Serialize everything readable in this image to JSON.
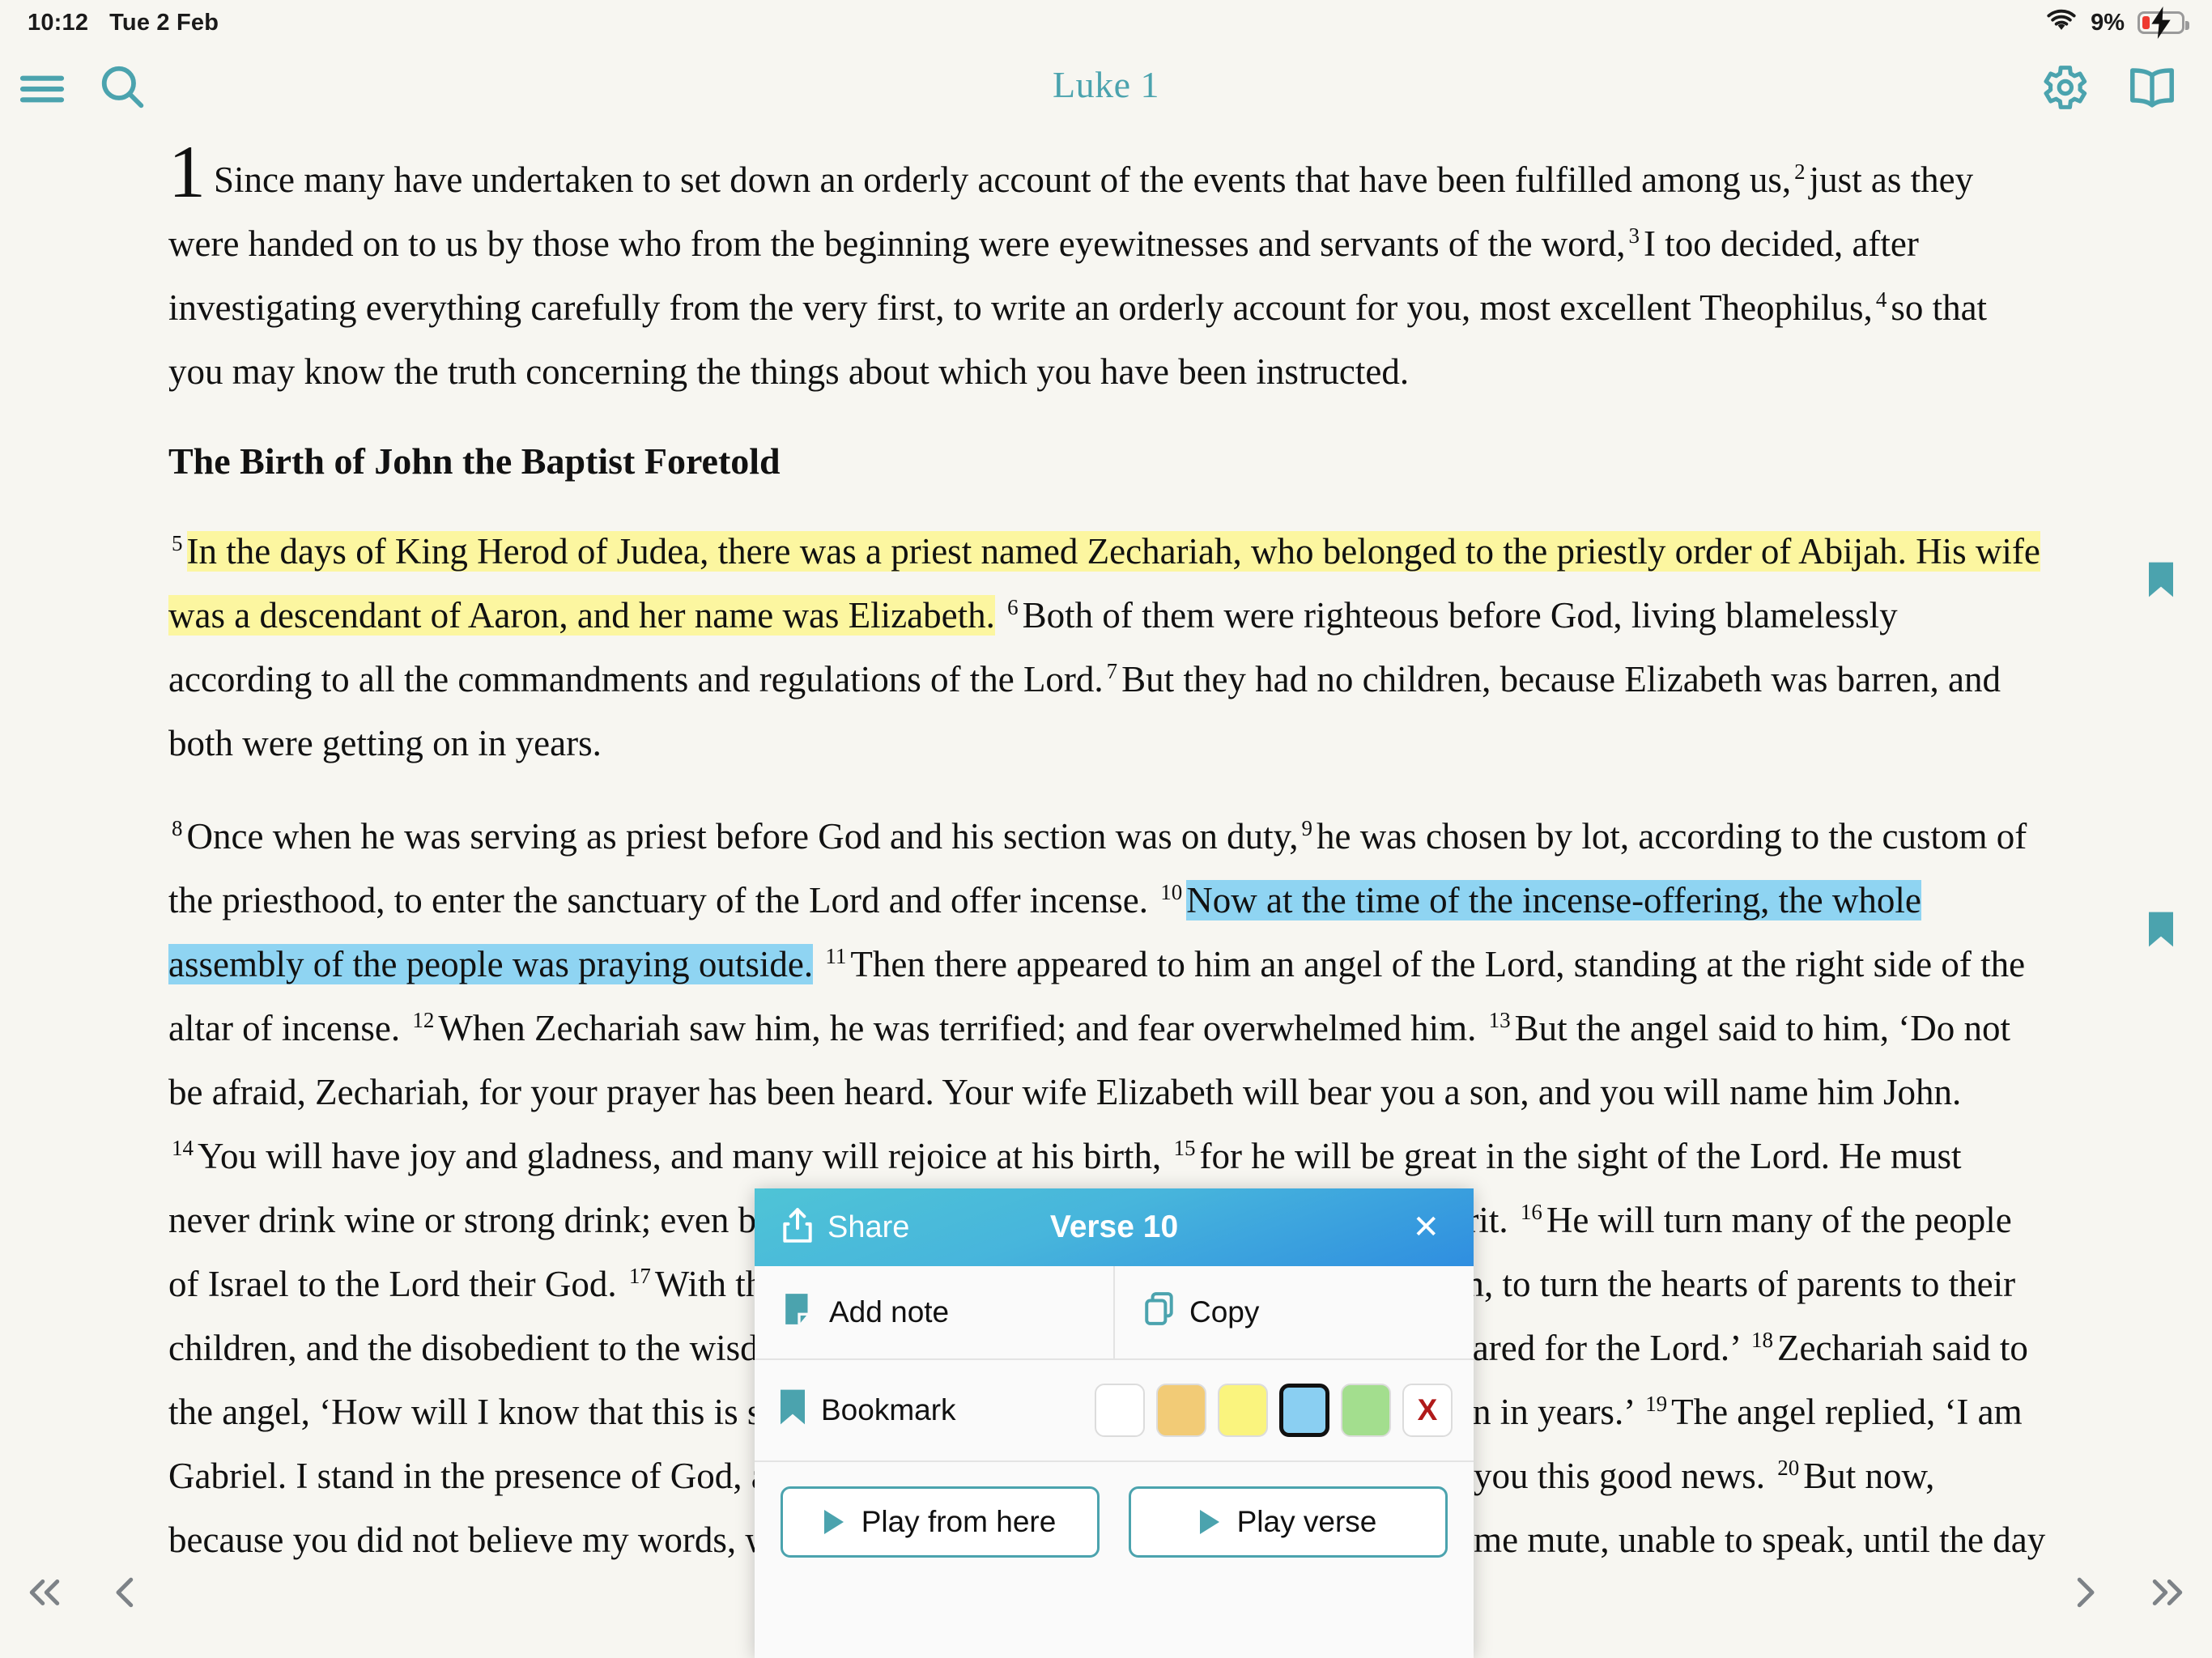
{
  "status_bar": {
    "time": "10:12",
    "date": "Tue 2 Feb",
    "battery_percent": "9%",
    "wifi_icon": "wifi-icon",
    "battery_icon": "battery-charging-icon"
  },
  "toolbar": {
    "menu_icon": "hamburger-menu-icon",
    "search_icon": "search-icon",
    "title": "Luke 1",
    "settings_icon": "gear-icon",
    "book_icon": "open-book-icon",
    "accent_color": "#4BA3AE"
  },
  "chapter": {
    "paragraphs": [
      {
        "id": "p1",
        "dropcap": "1",
        "runs": [
          {
            "text": "Since many have undertaken to set down an orderly account of the events that have been fulfilled among us,",
            "style": "plain"
          },
          {
            "text": "2",
            "style": "versenum"
          },
          {
            "text": "just as they were handed on to us by those who from the beginning were eyewitnesses and servants of the word,",
            "style": "plain"
          },
          {
            "text": "3",
            "style": "versenum"
          },
          {
            "text": "I too decided, after investigating everything carefully from the very first, to write an orderly account for you, most excellent Theophilus,",
            "style": "plain"
          },
          {
            "text": "4",
            "style": "versenum"
          },
          {
            "text": "so that you may know the truth concerning the things about which you have been instructed.",
            "style": "plain"
          }
        ]
      }
    ],
    "heading": "The Birth of John the Baptist Foretold",
    "paragraph2": {
      "id": "p2",
      "runs": [
        {
          "text": "5",
          "style": "versenum"
        },
        {
          "text": "In the days of King Herod of Judea, there was a priest named Zechariah, who belonged to the priestly order of Abijah. His wife was a descendant of Aaron, and her name was Elizabeth.",
          "style": "highlight-yellow"
        },
        {
          "text": "6",
          "style": "versenum"
        },
        {
          "text": "Both of them were righteous before God, living blamelessly according to all the commandments and regulations of the Lord.",
          "style": "plain"
        },
        {
          "text": "7",
          "style": "versenum"
        },
        {
          "text": "But they had no children, because Elizabeth was barren, and both were getting on in years.",
          "style": "plain"
        }
      ]
    },
    "paragraph3": {
      "id": "p3",
      "runs": [
        {
          "text": "8",
          "style": "versenum"
        },
        {
          "text": "Once when he was serving as priest before God and his section was on duty,",
          "style": "plain"
        },
        {
          "text": "9",
          "style": "versenum"
        },
        {
          "text": "he was chosen by lot, according to the custom of the priesthood, to enter the sanctuary of the Lord and offer incense.",
          "style": "plain"
        },
        {
          "text": "10",
          "style": "versenum"
        },
        {
          "text": "Now at the time of the incense-offering, the whole assembly of the people was praying outside.",
          "style": "highlight-blue"
        },
        {
          "text": "11",
          "style": "versenum"
        },
        {
          "text": "Then there appeared to him an angel of the Lord, standing at the right side of the altar of incense.",
          "style": "plain"
        },
        {
          "text": "12",
          "style": "versenum"
        },
        {
          "text": "When Zechariah saw him, he was terrified; and fear overwhelmed him.",
          "style": "plain"
        },
        {
          "text": "13",
          "style": "versenum"
        },
        {
          "text": "But the angel said to him, ‘Do not be afraid, Zechariah, for your prayer has been heard. Your wife Elizabeth will bear you a son, and you will name him John.",
          "style": "plain"
        },
        {
          "text": "14",
          "style": "versenum"
        },
        {
          "text": "You will have joy and gladness, and many will rejoice at his birth,",
          "style": "plain"
        },
        {
          "text": "15",
          "style": "versenum"
        },
        {
          "text": "for he will be great in the sight of the Lord. He must never drink wine or strong drink; even before his birth he will be filled with the Holy Spirit.",
          "style": "plain"
        },
        {
          "text": "16",
          "style": "versenum"
        },
        {
          "text": "He will turn many of the people of Israel to the Lord their God.",
          "style": "plain"
        },
        {
          "text": "17",
          "style": "versenum"
        },
        {
          "text": "With the spirit and power of Elijah he will go before him, to turn the hearts of parents to their children, and the disobedient to the wisdom of the righteous, to make ready a people prepared for the Lord.’",
          "style": "plain"
        },
        {
          "text": "18",
          "style": "versenum"
        },
        {
          "text": "Zechariah said to the angel, ‘How will I know that this is so? For I am an old man, and my wife is getting on in years.’",
          "style": "plain"
        },
        {
          "text": "19",
          "style": "versenum"
        },
        {
          "text": "The angel replied, ‘I am Gabriel. I stand in the presence of God, and I have been sent to speak to you and to bring you this good news.",
          "style": "plain"
        },
        {
          "text": "20",
          "style": "versenum"
        },
        {
          "text": "But now, because you did not believe my words, which will be fulfilled in their time, you will become mute, unable to speak, until the day these things occur.’",
          "style": "plain"
        }
      ]
    },
    "bookmarks": [
      {
        "name": "bookmark-ribbon-verse-5",
        "color": "#4BA3AE"
      },
      {
        "name": "bookmark-ribbon-verse-10",
        "color": "#4BA3AE"
      }
    ],
    "highlight_colors": {
      "yellow": "#FCF6A0",
      "blue": "#8FD4F2"
    }
  },
  "bottom_nav": {
    "first_icon": "chevron-double-left-icon",
    "prev_icon": "chevron-left-icon",
    "next_icon": "chevron-right-icon",
    "last_icon": "chevron-double-right-icon",
    "arrow_color": "#7D8287"
  },
  "popup": {
    "share_label": "Share",
    "share_icon": "share-upload-icon",
    "title": "Verse 10",
    "close_label": "✕",
    "add_note_label": "Add note",
    "add_note_icon": "note-icon",
    "copy_label": "Copy",
    "copy_icon": "copy-icon",
    "bookmark_label": "Bookmark",
    "bookmark_icon": "bookmark-icon",
    "swatches": [
      {
        "name": "highlight-none",
        "color": "#FFFFFF",
        "selected": false,
        "label": ""
      },
      {
        "name": "highlight-orange",
        "color": "#F2CB76",
        "selected": false,
        "label": ""
      },
      {
        "name": "highlight-yellow",
        "color": "#FAF47E",
        "selected": false,
        "label": ""
      },
      {
        "name": "highlight-blue",
        "color": "#8ACFF2",
        "selected": true,
        "label": ""
      },
      {
        "name": "highlight-green",
        "color": "#A3DE8E",
        "selected": false,
        "label": ""
      },
      {
        "name": "highlight-clear",
        "color": "#FFFFFF",
        "selected": false,
        "label": "X"
      }
    ],
    "play_from_here_label": "Play from here",
    "play_verse_label": "Play verse",
    "header_gradient_start": "#4FC4D6",
    "header_gradient_end": "#2F8EE0"
  }
}
